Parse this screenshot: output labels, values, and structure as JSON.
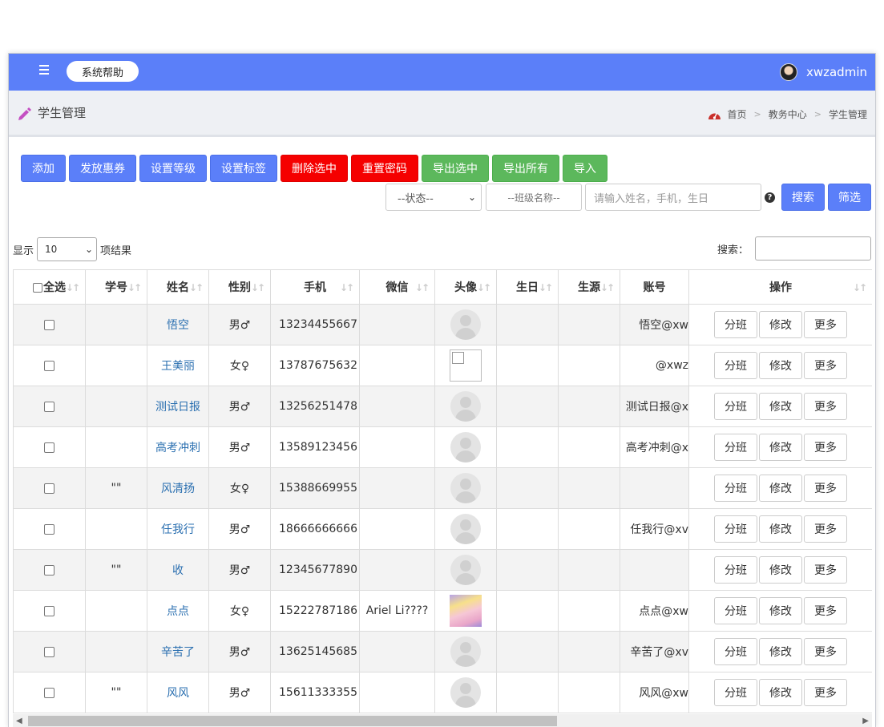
{
  "topbar": {
    "help_label": "系统帮助",
    "username": "xwzadmin"
  },
  "header": {
    "title": "学生管理",
    "breadcrumb": [
      "首页",
      "教务中心",
      "学生管理"
    ]
  },
  "toolbar": [
    {
      "label": "添加",
      "color": "blue"
    },
    {
      "label": "发放惠券",
      "color": "blue"
    },
    {
      "label": "设置等级",
      "color": "blue"
    },
    {
      "label": "设置标签",
      "color": "blue"
    },
    {
      "label": "删除选中",
      "color": "red"
    },
    {
      "label": "重置密码",
      "color": "red"
    },
    {
      "label": "导出选中",
      "color": "green"
    },
    {
      "label": "导出所有",
      "color": "green"
    },
    {
      "label": "导入",
      "color": "green"
    }
  ],
  "filters": {
    "status_value": "--状态--",
    "class_placeholder": "--班级名称--",
    "search_placeholder": "请输入姓名，手机，生日",
    "help_glyph": "?",
    "search_label": "搜索",
    "filter_label": "筛选"
  },
  "length": {
    "prefix": "显示",
    "value": "10",
    "suffix": "项结果"
  },
  "search": {
    "label": "搜索：",
    "value": ""
  },
  "table": {
    "headers": [
      "全选",
      "学号",
      "姓名",
      "性别",
      "手机",
      "微信",
      "头像",
      "生日",
      "生源",
      "账号",
      "操作"
    ],
    "op_labels": [
      "分班",
      "修改",
      "更多"
    ],
    "rows": [
      {
        "id": "",
        "name": "悟空",
        "gender": "男♂",
        "phone": "13234455667",
        "wechat": "",
        "avatar": "default",
        "birthday": "",
        "source": "",
        "account": "悟空@xw"
      },
      {
        "id": "",
        "name": "王美丽",
        "gender": "女♀",
        "phone": "13787675632",
        "wechat": "",
        "avatar": "broken",
        "birthday": "",
        "source": "",
        "account": "@xwz"
      },
      {
        "id": "",
        "name": "测试日报",
        "gender": "男♂",
        "phone": "13256251478",
        "wechat": "",
        "avatar": "default",
        "birthday": "",
        "source": "",
        "account": "测试日报@x"
      },
      {
        "id": "",
        "name": "高考冲刺",
        "gender": "男♂",
        "phone": "13589123456",
        "wechat": "",
        "avatar": "default",
        "birthday": "",
        "source": "",
        "account": "高考冲刺@x"
      },
      {
        "id": "\"\"",
        "name": "风清扬",
        "gender": "女♀",
        "phone": "15388669955",
        "wechat": "",
        "avatar": "default",
        "birthday": "",
        "source": "",
        "account": ""
      },
      {
        "id": "",
        "name": "任我行",
        "gender": "男♂",
        "phone": "18666666666",
        "wechat": "",
        "avatar": "default",
        "birthday": "",
        "source": "",
        "account": "任我行@xv"
      },
      {
        "id": "\"\"",
        "name": "收",
        "gender": "男♂",
        "phone": "12345677890",
        "wechat": "",
        "avatar": "default",
        "birthday": "",
        "source": "",
        "account": ""
      },
      {
        "id": "",
        "name": "点点",
        "gender": "女♀",
        "phone": "15222787186",
        "wechat": "Ariel Li????",
        "avatar": "anime",
        "birthday": "",
        "source": "",
        "account": "点点@xw"
      },
      {
        "id": "",
        "name": "辛苦了",
        "gender": "男♂",
        "phone": "13625145685",
        "wechat": "",
        "avatar": "default",
        "birthday": "",
        "source": "",
        "account": "辛苦了@xv"
      },
      {
        "id": "\"\"",
        "name": "风风",
        "gender": "男♂",
        "phone": "15611333355",
        "wechat": "",
        "avatar": "default",
        "birthday": "",
        "source": "",
        "account": "风风@xw"
      }
    ]
  },
  "colors": {
    "primary": "#5b7ff9",
    "danger": "#f50000",
    "success": "#5cb85c",
    "link": "#2a6fb0"
  }
}
